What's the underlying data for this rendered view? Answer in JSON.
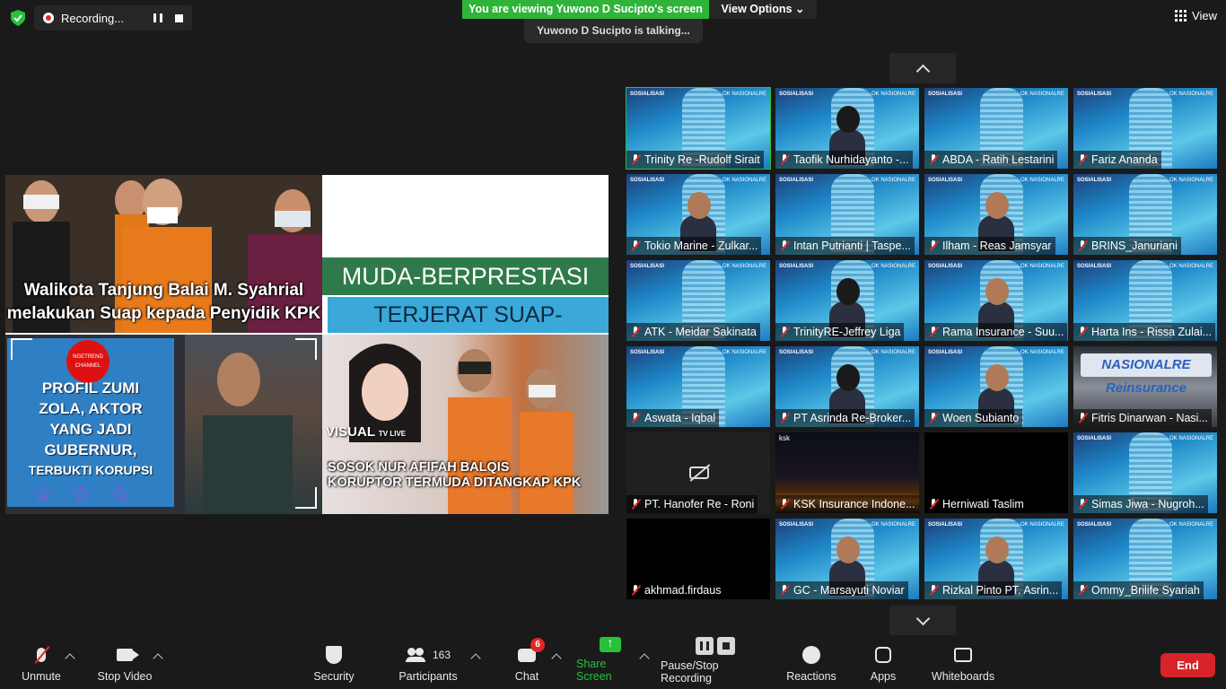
{
  "recording": {
    "label": "Recording..."
  },
  "banner": {
    "viewing": "You are viewing Yuwono D Sucipto's screen",
    "view_options": "View Options",
    "talking": "Yuwono D Sucipto is talking..."
  },
  "view": {
    "label": "View"
  },
  "shared": {
    "caption1_l1": "Walikota Tanjung Balai M. Syahrial",
    "caption1_l2": "melakukan Suap kepada Penyidik KPK",
    "band1": "MUDA-BERPRESTASI",
    "band2": "TERJERAT SUAP-KORUPSI",
    "channel": "NGETREND CHANNEL",
    "profil": [
      "PROFIL ZUMI",
      "ZOLA, AKTOR",
      "YANG JADI",
      "GUBERNUR,",
      "TERBUKTI KORUPSI"
    ],
    "stars": "☆☆☆",
    "visual_logo": "VISUAL",
    "visual_sub": "TV LIVE",
    "caption4_l1": "SOSOK NUR AFIFAH BALQIS",
    "caption4_l2": "KORUPTOR TERMUDA DITANGKAP KPK"
  },
  "tile_header": {
    "title": "SOSIALISASI",
    "ok": "OK NASIONALRE"
  },
  "tiles": [
    {
      "name": "Trinity Re -Rudolf Sirait",
      "bg": "blue",
      "person": false,
      "selected": true
    },
    {
      "name": "Taofik Nurhidayanto -...",
      "bg": "blue",
      "person": "dark",
      "selected": false
    },
    {
      "name": "ABDA - Ratih Lestarini",
      "bg": "blue",
      "person": false,
      "selected": false
    },
    {
      "name": "Fariz Ananda",
      "bg": "blue",
      "person": false,
      "selected": false
    },
    {
      "name": "Tokio Marine - Zulkar...",
      "bg": "blue",
      "person": "face",
      "selected": false
    },
    {
      "name": "Intan Putrianti | Taspe...",
      "bg": "blue",
      "person": false,
      "selected": false
    },
    {
      "name": "Ilham - Reas Jamsyar",
      "bg": "blue",
      "person": "face",
      "selected": false
    },
    {
      "name": "BRINS_Januriani",
      "bg": "blue",
      "person": false,
      "selected": false
    },
    {
      "name": "ATK - Meidar Sakinata",
      "bg": "blue",
      "person": false,
      "selected": false
    },
    {
      "name": "TrinityRE-Jeffrey Liga",
      "bg": "blue",
      "person": "dark",
      "selected": false
    },
    {
      "name": "Rama Insurance - Suu...",
      "bg": "blue",
      "person": "face",
      "selected": false
    },
    {
      "name": "Harta Ins - Rissa Zulai...",
      "bg": "blue",
      "person": false,
      "selected": false
    },
    {
      "name": "Aswata - Iqbal",
      "bg": "blue",
      "person": false,
      "selected": false
    },
    {
      "name": "PT Asrinda Re-Broker...",
      "bg": "blue",
      "person": "dark",
      "selected": false
    },
    {
      "name": "Woen Subianto",
      "bg": "blue",
      "person": "face",
      "selected": false
    },
    {
      "name": "Fitris Dinarwan - Nasi...",
      "bg": "nasional",
      "person": false,
      "selected": false
    },
    {
      "name": "PT. Hanofer Re - Roni",
      "bg": "off",
      "person": false,
      "selected": false
    },
    {
      "name": "KSK Insurance Indone...",
      "bg": "city",
      "person": false,
      "selected": false
    },
    {
      "name": "Herniwati Taslim",
      "bg": "black",
      "person": false,
      "selected": false
    },
    {
      "name": "Simas Jiwa - Nugroh...",
      "bg": "blue",
      "person": false,
      "selected": false
    },
    {
      "name": "akhmad.firdaus",
      "bg": "black",
      "person": false,
      "selected": false
    },
    {
      "name": "GC - Marsayuti Noviar",
      "bg": "blue",
      "person": "face",
      "selected": false
    },
    {
      "name": "Rizkal Pinto PT. Asrin...",
      "bg": "blue",
      "person": "face",
      "selected": false
    },
    {
      "name": "Ommy_Brilife Syariah",
      "bg": "blue",
      "person": false,
      "selected": false
    }
  ],
  "nasional_sign": "NASIONALRE Reinsurance",
  "city_label": "ksk",
  "toolbar": {
    "unmute": "Unmute",
    "stop_video": "Stop Video",
    "security": "Security",
    "participants": "Participants",
    "participants_count": "163",
    "chat": "Chat",
    "chat_badge": "6",
    "share": "Share Screen",
    "pause_stop": "Pause/Stop Recording",
    "reactions": "Reactions",
    "apps": "Apps",
    "whiteboards": "Whiteboards",
    "end": "End"
  },
  "colors": {
    "share_green": "#27c23a",
    "end_red": "#d8232a",
    "banner_green": "#2fb43a"
  }
}
